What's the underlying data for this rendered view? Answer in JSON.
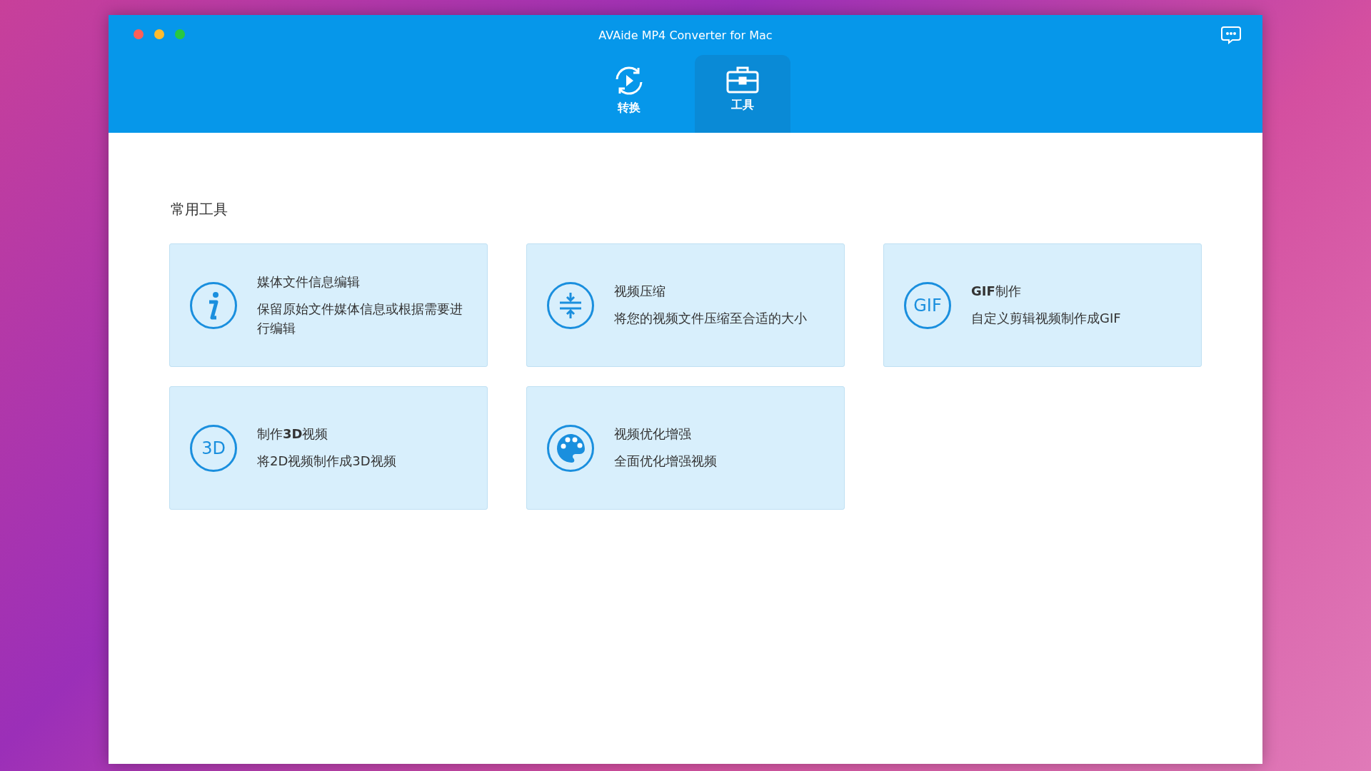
{
  "window": {
    "title": "AVAide MP4 Converter for Mac"
  },
  "tabs": [
    {
      "label": "转换",
      "kind": "convert",
      "selected": false
    },
    {
      "label": "工具",
      "kind": "toolbox",
      "selected": true
    }
  ],
  "section": {
    "title": "常用工具"
  },
  "tools": [
    {
      "kind": "info",
      "title": "媒体文件信息编辑",
      "description": "保留原始文件媒体信息或根据需要进行编辑"
    },
    {
      "kind": "compress",
      "title": "视频压缩",
      "description": "将您的视频文件压缩至合适的大小"
    },
    {
      "kind": "badge",
      "icon_text": "GIF",
      "title": "**GIF**制作",
      "description": "自定义剪辑视频制作成GIF"
    },
    {
      "kind": "badge",
      "icon_text": "3D",
      "title": "制作**3D**视频",
      "description": "将2D视频制作成3D视频"
    },
    {
      "kind": "palette",
      "title": "视频优化增强",
      "description": "全面优化增强视频"
    }
  ]
}
